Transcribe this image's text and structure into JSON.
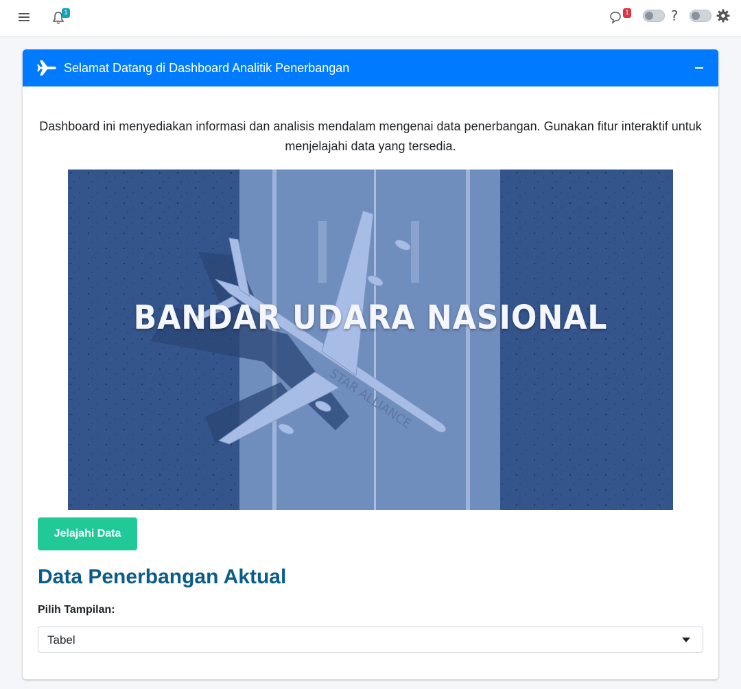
{
  "navbar": {
    "menu_icon": "hamburger-icon",
    "notifications_badge": "1",
    "messages_badge": "1",
    "help_label": "?",
    "settings_icon": "gear-icon"
  },
  "card": {
    "title": "Selamat Datang di Dashboard Analitik Penerbangan",
    "collapse_icon": "minus-icon",
    "intro_text": "Dashboard ini menyediakan informasi dan analisis mendalam mengenai data penerbangan. Gunakan fitur interaktif untuk menjelajahi data yang tersedia.",
    "hero_text": "BANDAR UDARA NASIONAL",
    "hero_aircraft_text": "STAR ALLIANCE",
    "explore_button": "Jelajahi Data",
    "section_title": "Data Penerbangan Aktual",
    "select_label": "Pilih Tampilan:",
    "select_value": "Tabel"
  },
  "colors": {
    "header": "#007bff",
    "button": "#20c997",
    "section_title": "#0b5c8a",
    "hero_tint": "#2f4f86"
  }
}
